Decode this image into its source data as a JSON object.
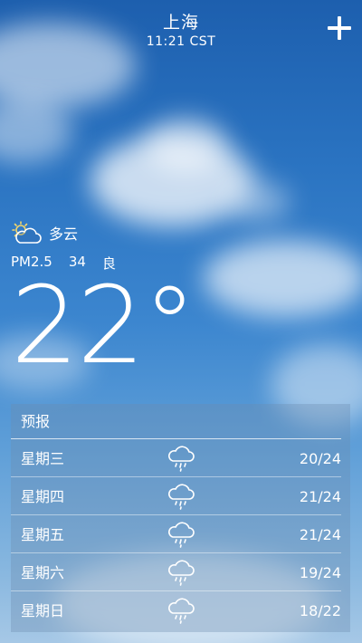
{
  "header": {
    "city": "上海",
    "time": "11:21 CST"
  },
  "current": {
    "condition": "多云",
    "condition_icon": "partly-cloudy-icon",
    "aqi_label": "PM2.5",
    "aqi_value": "34",
    "aqi_level": "良",
    "temperature": "22°"
  },
  "forecast": {
    "title": "预报",
    "days": [
      {
        "day": "星期三",
        "icon": "rain-cloud-icon",
        "range": "20/24"
      },
      {
        "day": "星期四",
        "icon": "rain-cloud-icon",
        "range": "21/24"
      },
      {
        "day": "星期五",
        "icon": "rain-cloud-icon",
        "range": "21/24"
      },
      {
        "day": "星期六",
        "icon": "rain-cloud-icon",
        "range": "19/24"
      },
      {
        "day": "星期日",
        "icon": "rain-cloud-icon",
        "range": "18/22"
      }
    ]
  }
}
